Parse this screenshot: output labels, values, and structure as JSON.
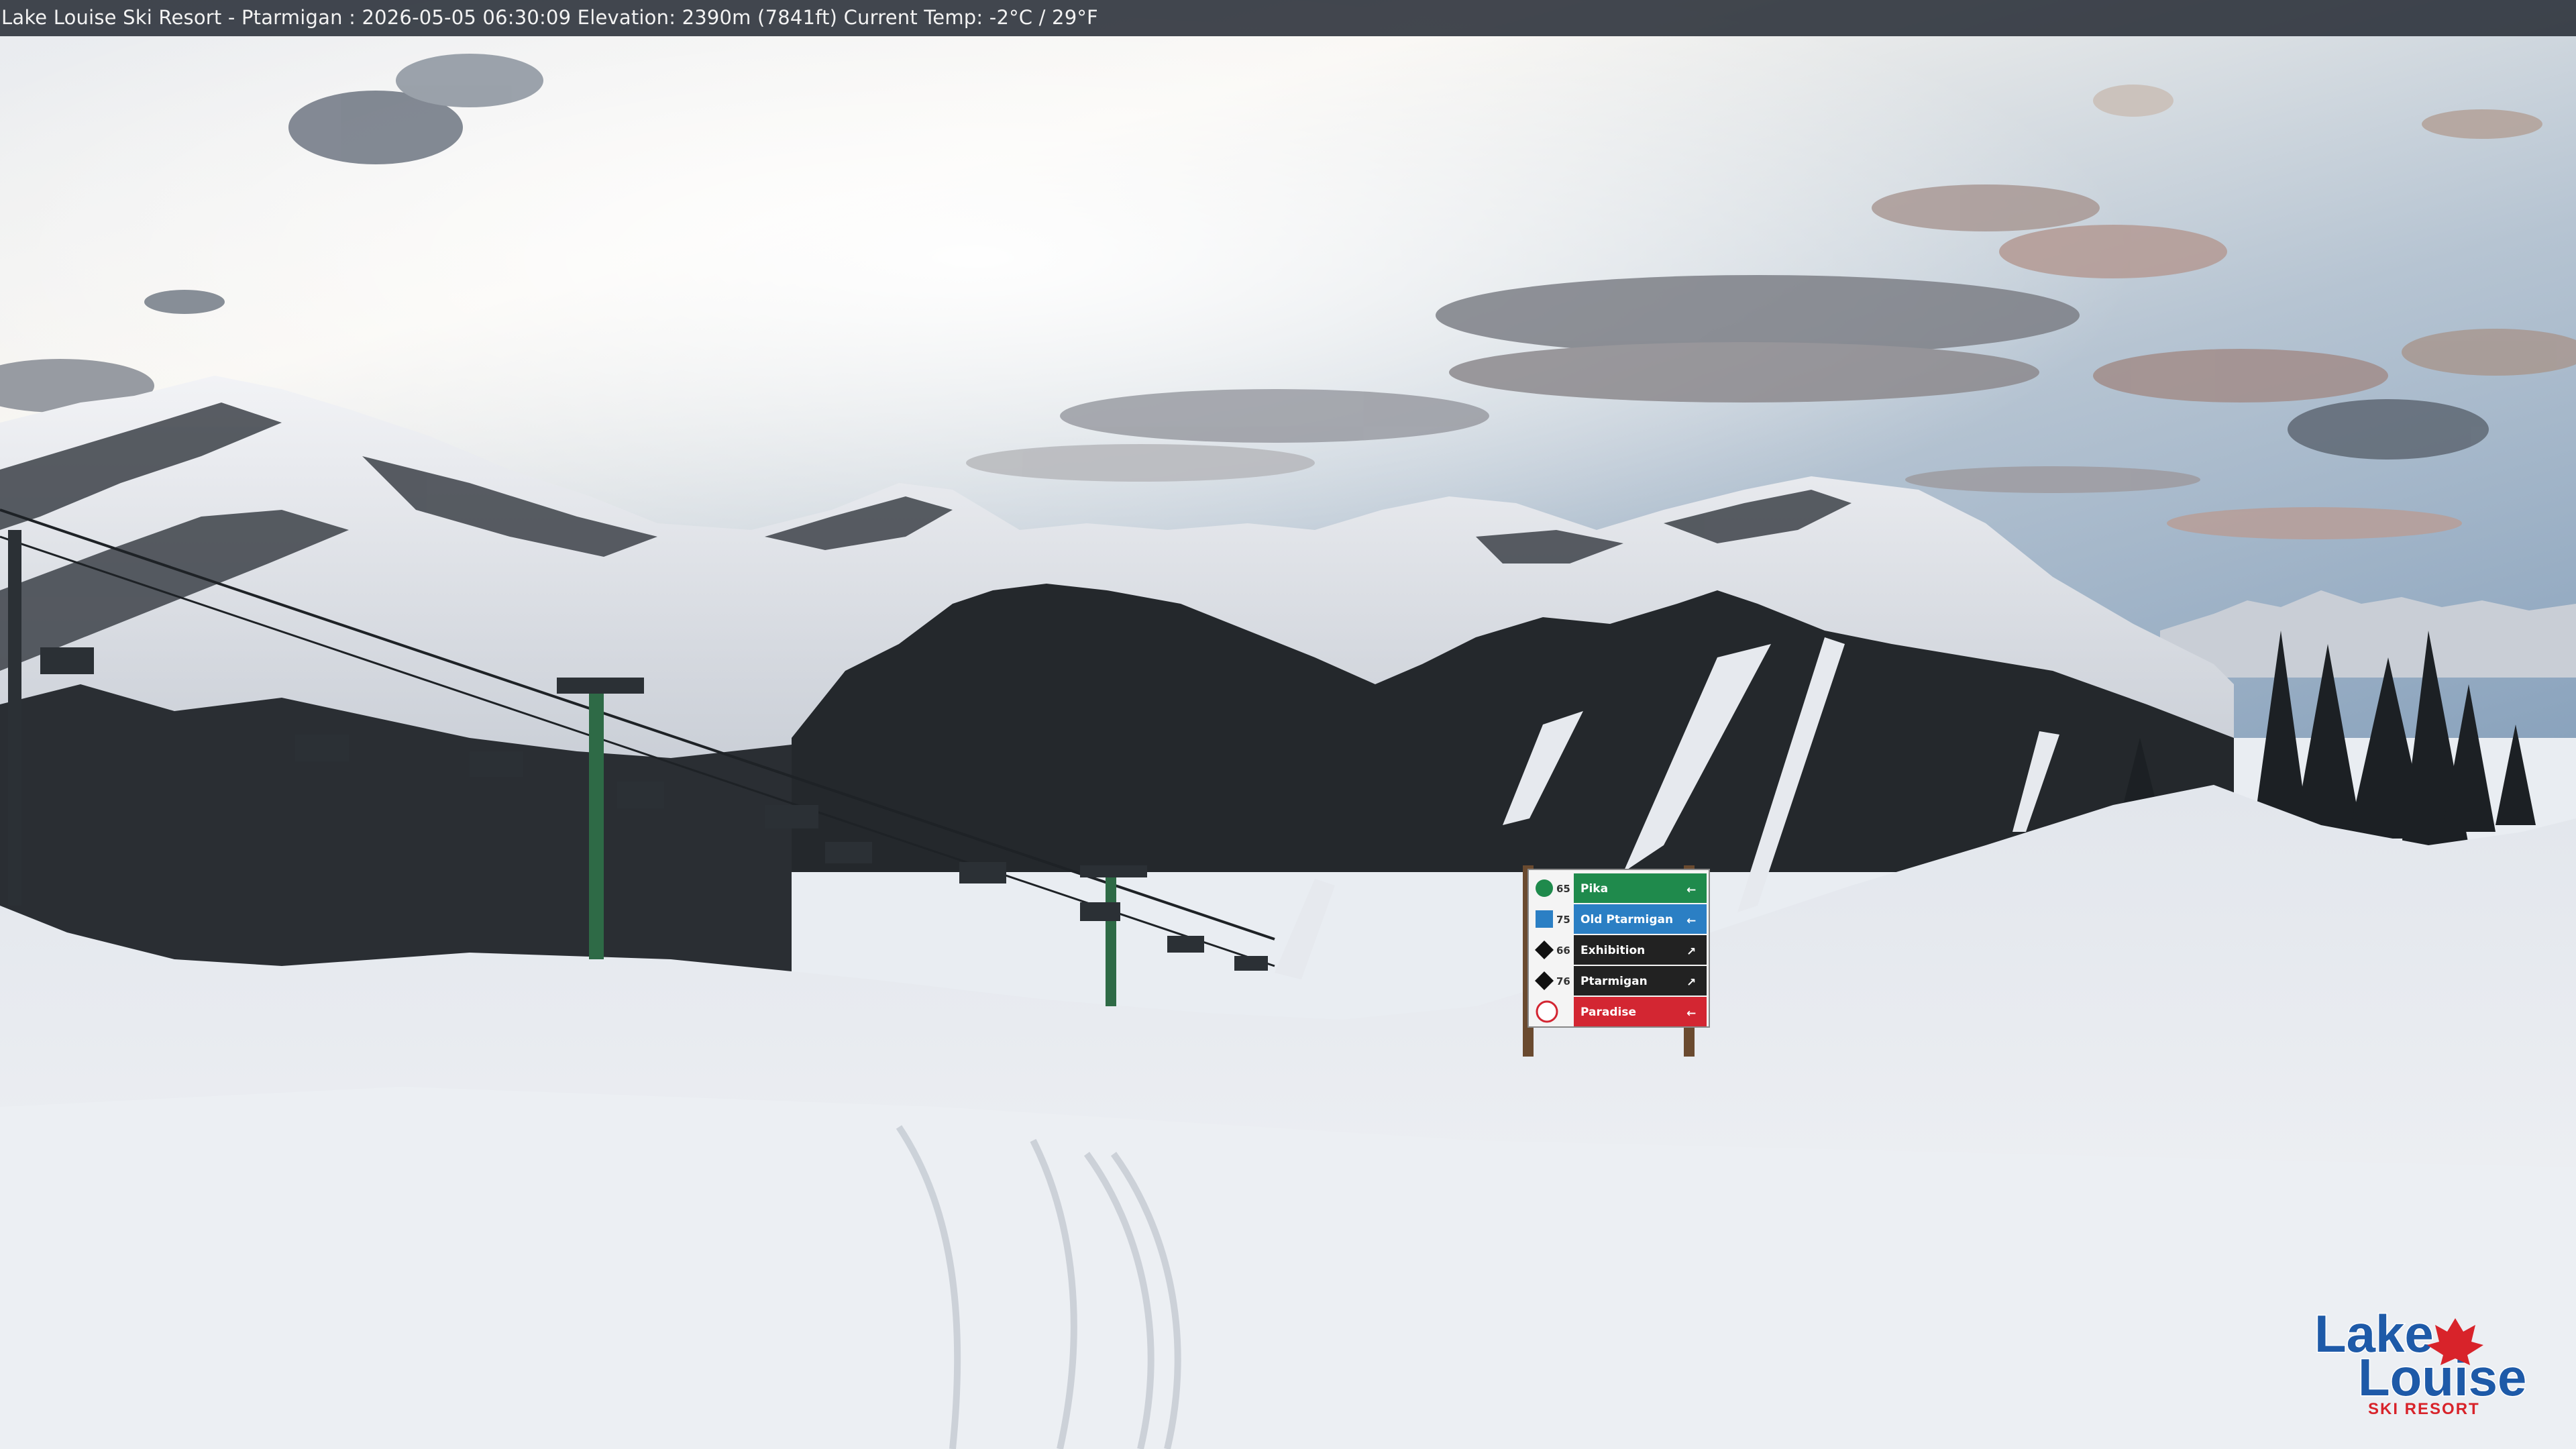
{
  "overlay": {
    "caption": "Lake Louise Ski Resort - Ptarmigan : 2026-05-05 06:30:09  Elevation: 2390m (7841ft) Current Temp: -2°C / 29°F"
  },
  "sign": {
    "runs": [
      {
        "number": "65",
        "name": "Pika",
        "color": "#1f8a4c",
        "symbol": "green-circle",
        "arrow": "←"
      },
      {
        "number": "75",
        "name": "Old Ptarmigan",
        "color": "#2b7fc4",
        "symbol": "blue-square",
        "arrow": "←"
      },
      {
        "number": "66",
        "name": "Exhibition",
        "color": "#222222",
        "symbol": "double-black-diamond",
        "arrow": "↗"
      },
      {
        "number": "76",
        "name": "Ptarmigan",
        "color": "#222222",
        "symbol": "black-diamond",
        "arrow": "↗"
      },
      {
        "number": "",
        "name": "Paradise",
        "color": "#d32632",
        "symbol": "chairlift",
        "arrow": "←"
      }
    ]
  },
  "logo": {
    "line1": "Lake",
    "line2": "Louise",
    "line3": "SKI RESORT",
    "brand_color": "#1e5aa8",
    "accent_color": "#d8232a"
  },
  "colors": {
    "sky_top": "#8fa8c0",
    "sky_glow": "#f7f4ef",
    "snow": "#eef1f5",
    "forest": "#1a1d1f"
  }
}
